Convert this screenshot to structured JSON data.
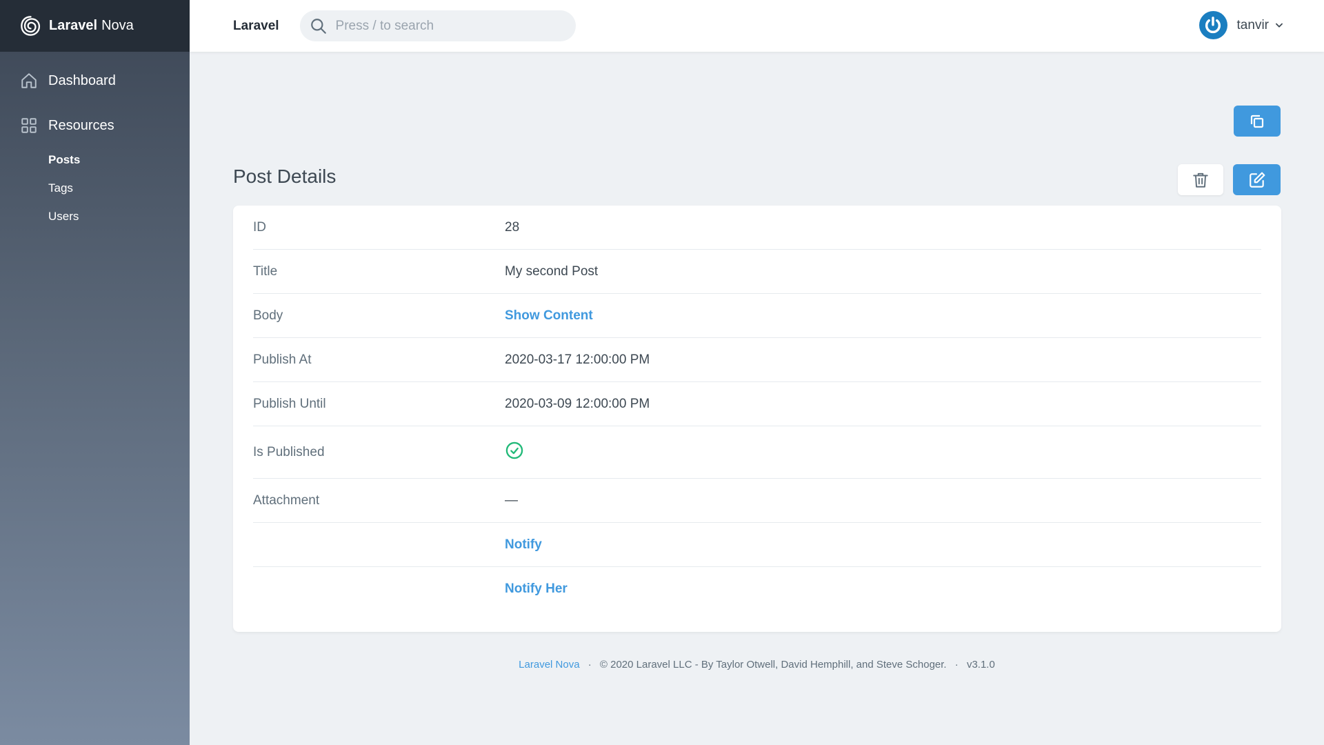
{
  "brand": {
    "bold": "Laravel",
    "light": "Nova"
  },
  "sidebar": {
    "nav": [
      {
        "label": "Dashboard",
        "icon": "home-icon"
      },
      {
        "label": "Resources",
        "icon": "grid-icon"
      }
    ],
    "resources": [
      {
        "label": "Posts",
        "active": true
      },
      {
        "label": "Tags",
        "active": false
      },
      {
        "label": "Users",
        "active": false
      }
    ]
  },
  "header": {
    "app_name": "Laravel",
    "search_placeholder": "Press / to search",
    "user_name": "tanvir"
  },
  "main": {
    "title": "Post Details",
    "fields": [
      {
        "label": "ID",
        "value": "28"
      },
      {
        "label": "Title",
        "value": "My second Post"
      },
      {
        "label": "Body",
        "value": "Show Content"
      },
      {
        "label": "Publish At",
        "value": "2020-03-17 12:00:00 PM"
      },
      {
        "label": "Publish Until",
        "value": "2020-03-09 12:00:00 PM"
      },
      {
        "label": "Is Published",
        "value": "check-circle-icon"
      },
      {
        "label": "Attachment",
        "value": "—"
      },
      {
        "label": "",
        "value": "Notify"
      },
      {
        "label": "",
        "value": "Notify Her"
      }
    ]
  },
  "footer": {
    "link": "Laravel Nova",
    "copyright": "© 2020 Laravel LLC - By Taylor Otwell, David Hemphill, and Steve Schoger.",
    "version": "v3.1.0"
  },
  "colors": {
    "primary": "#4099de",
    "sidebar_top": "#252d37",
    "success": "#21b978",
    "background": "#eef1f4"
  }
}
